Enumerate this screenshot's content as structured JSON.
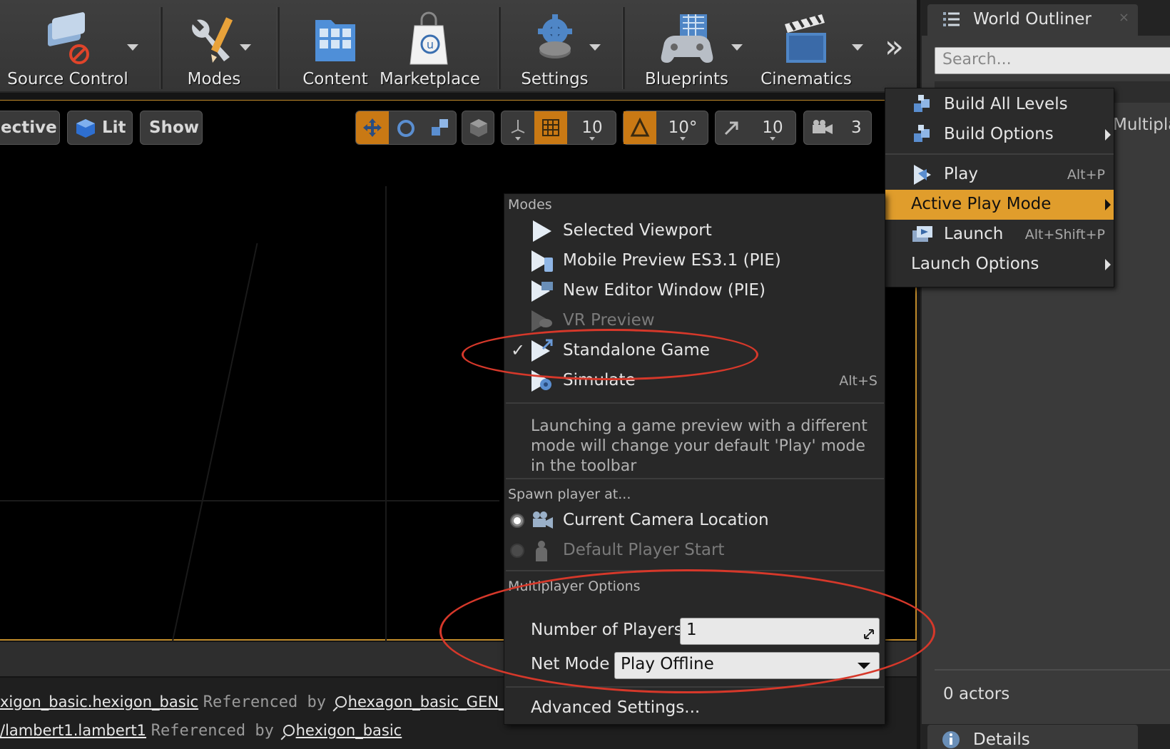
{
  "toolbar": {
    "source_control": "Source Control",
    "modes": "Modes",
    "content": "Content",
    "marketplace": "Marketplace",
    "settings": "Settings",
    "blueprints": "Blueprints",
    "cinematics": "Cinematics"
  },
  "viewport": {
    "perspective": "ective",
    "lit": "Lit",
    "show": "Show",
    "grid_snap": "10",
    "rotation_snap": "10°",
    "scale_snap": "10",
    "camera_speed": "3"
  },
  "log": {
    "line1_left": "xigon_basic.hexigon_basic",
    "line1_mid": "Referenced by",
    "line1_right": "hexagon_basic_GEN_VAR",
    "line2_left": "/lambert1.lambert1",
    "line2_mid": "Referenced by",
    "line2_right": "hexigon_basic"
  },
  "world_outliner": {
    "title": "World Outliner",
    "close": "×",
    "search_placeholder": "Search...",
    "partial_label": "Multipla",
    "actor_count": "0 actors"
  },
  "details": {
    "title": "Details"
  },
  "play_menu": {
    "items": [
      {
        "label": "Build All Levels",
        "shortcut": ""
      },
      {
        "label": "Build Options",
        "shortcut": ""
      },
      {
        "label": "Play",
        "shortcut": "Alt+P"
      },
      {
        "label": "Active Play Mode",
        "shortcut": ""
      },
      {
        "label": "Launch",
        "shortcut": "Alt+Shift+P"
      },
      {
        "label": "Launch Options",
        "shortcut": ""
      }
    ]
  },
  "modes_menu": {
    "modes_header": "Modes",
    "items": [
      {
        "label": "Selected Viewport",
        "shortcut": ""
      },
      {
        "label": "Mobile Preview ES3.1 (PIE)",
        "shortcut": ""
      },
      {
        "label": "New Editor Window (PIE)",
        "shortcut": ""
      },
      {
        "label": "VR Preview",
        "shortcut": ""
      },
      {
        "label": "Standalone Game",
        "shortcut": "",
        "checked": true
      },
      {
        "label": "Simulate",
        "shortcut": "Alt+S"
      }
    ],
    "note": "Launching a game preview with a different mode will change your default 'Play' mode in the toolbar",
    "spawn_header": "Spawn player at...",
    "spawn_options": [
      {
        "label": "Current Camera Location",
        "selected": true
      },
      {
        "label": "Default Player Start",
        "selected": false
      }
    ],
    "multiplayer_header": "Multiplayer Options",
    "num_players_label": "Number of Players",
    "num_players_value": "1",
    "net_mode_label": "Net Mode",
    "net_mode_value": "Play Offline",
    "advanced": "Advanced Settings..."
  },
  "colors": {
    "highlight": "#e09d2c",
    "annotation": "#d6382a",
    "viewport_border": "#c08a2a"
  }
}
